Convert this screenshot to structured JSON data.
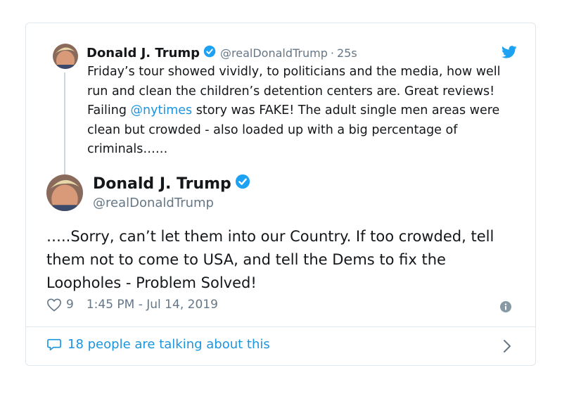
{
  "parent_tweet": {
    "name": "Donald J. Trump",
    "handle": "@realDonaldTrump",
    "separator": "·",
    "time": "25s",
    "text_before_mention": "Friday’s tour showed vividly, to politicians and the media, how well run and clean the children’s detention centers are. Great reviews! Failing ",
    "mention": "@nytimes",
    "text_after_mention": " story was FAKE! The adult single men areas were clean but crowded - also loaded up with a big percentage of criminals……"
  },
  "main_tweet": {
    "name": "Donald J. Trump",
    "handle": "@realDonaldTrump",
    "text": "…..Sorry, can’t let them into our Country. If too crowded, tell them not to come to USA, and tell the Dems to fix the Loopholes - Problem Solved!",
    "likes": "9",
    "timestamp": "1:45 PM - Jul 14, 2019"
  },
  "footer": {
    "talking_text": "18 people are talking about this"
  },
  "icons": {
    "verified": "verified-badge-icon",
    "bird": "twitter-bird-icon",
    "heart": "heart-icon",
    "info": "info-icon",
    "bubble": "speech-bubble-icon",
    "chevron": "chevron-right-icon"
  },
  "colors": {
    "accent": "#1b95e0",
    "text": "#14171a",
    "muted": "#657786",
    "border": "#e1e8ed"
  }
}
